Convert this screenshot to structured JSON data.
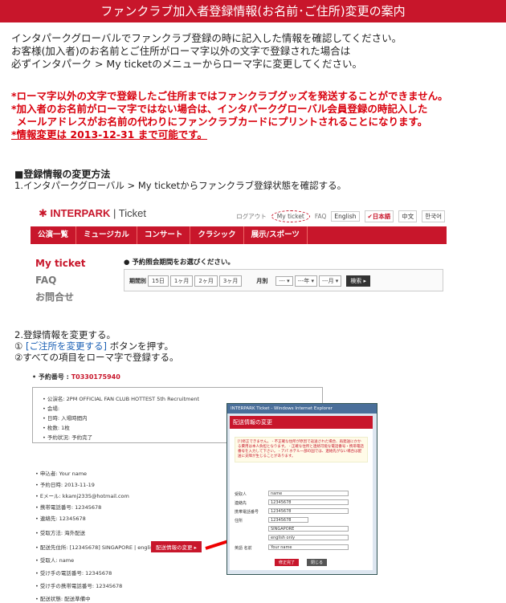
{
  "banner": {
    "title": "ファンクラブ加入者登録情報(お名前･ご住所)変更の案内"
  },
  "intro": {
    "line1": "インタパークグローバルでファンクラブ登録の時に記入した情報を確認してください。",
    "line2": "お客様(加入者)のお名前とご住所がローマ字以外の文字で登録された場合は",
    "line3": "必ずインタパーク > My ticketのメニューからローマ字に変更してください。"
  },
  "warnings": {
    "w1": "*ローマ字以外の文字で登録したご住所まではファンクラブグッズを発送することができません。",
    "w2a": "*加入者のお名前がローマ字ではない場合は、インタパークグローバル会員登録の時記入した",
    "w2b": "メールアドレスがお名前の代わりにファンクラブカードにプリントされることになります。",
    "w3": "*情報変更は 2013-12-31 まで可能です。"
  },
  "howto": {
    "title": "■登録情報の変更方法",
    "step1": "1.インタパークグローバル > My ticketからファンクラブ登録状態を確認する。",
    "step2": "2.登録情報を変更する。",
    "step2a_prefix": "①",
    "step2a_link": "[ご注所を変更する]",
    "step2a_suffix": "ボタンを押す。",
    "step2b": "②すべての項目をローマ字で登録する。"
  },
  "shot1": {
    "logo_brand": "INTERPARK",
    "logo_suffix": "| Ticket",
    "topnav": [
      "ログアウト",
      "My ticket",
      "FAQ"
    ],
    "langs": [
      "English",
      "✔日本語",
      "中文",
      "한국어"
    ],
    "menu": [
      "公演一覧",
      "ミュージカル",
      "コンサート",
      "クラシック",
      "展示/スポーツ"
    ],
    "side": [
      "My ticket",
      "FAQ",
      "お問合せ"
    ],
    "period_label": "● 予約照会期間をお選びください。",
    "period_by": "期間別",
    "periods": [
      "15日",
      "1ヶ月",
      "2ヶ月",
      "3ヶ月"
    ],
    "monthly": "月別",
    "dd_year": "---",
    "dd_year_suffix": "年",
    "dd_month": "---",
    "dd_month2": "月",
    "search_btn": "検索 ▸"
  },
  "shot2": {
    "resv_label": "• 予約番号 :",
    "resv_no": "T0330175940",
    "panel": [
      "• 公演名: 2PM OFFICIAL FAN CLUB HOTTEST 5th Recruitment",
      "• 会場:",
      "• 日時: 入場時間内",
      "• 枚数: 1枚",
      "• 予約状況: 予約完了"
    ],
    "details": [
      "• 申込者: Your name",
      "• 予約日時: 2013-11-19",
      "• Eメール: kkamj2335@hotmail.com",
      "• 携帯電話番号: 12345678",
      "• 連絡先: 12345678",
      "• 受取方法: 海外配送",
      "• 配送先住所: [12345678] SINGAPORE | english only",
      "• 受取人: name",
      "• 受け手の電話番号: 12345678",
      "• 受け手の携帯電話番号: 12345678",
      "• 配送状態: 配送準備中"
    ],
    "change_btn": "配送情報の変更 ▸",
    "popup": {
      "window_title": "INTERPARK Ticket - Windows Internet Explorer",
      "header": "配送情報の変更",
      "note": "[!]修正できません。 - 不正確な住所が原因で返送された場合、再発送にかかる費用は本人負担となります。 - 正確な住所と連絡可能な電話番号・携帯電話番号を入力して下さい。 - アパ ホテル一部の国では、連絡先がない場合は配送に支障が生じることがあります。",
      "rows": [
        {
          "label": "受取人",
          "value": "name"
        },
        {
          "label": "連絡先",
          "value": "12345678"
        },
        {
          "label": "携帯電話番号",
          "value": "12345678"
        },
        {
          "label": "住所",
          "value": "12345678"
        },
        {
          "label": "",
          "value": "SINGAPORE"
        },
        {
          "label": "",
          "value": "english only"
        },
        {
          "label": "英語 名前",
          "value": "Your name"
        }
      ],
      "ok_btn": "修正完了",
      "close_btn": "閉じる"
    }
  }
}
